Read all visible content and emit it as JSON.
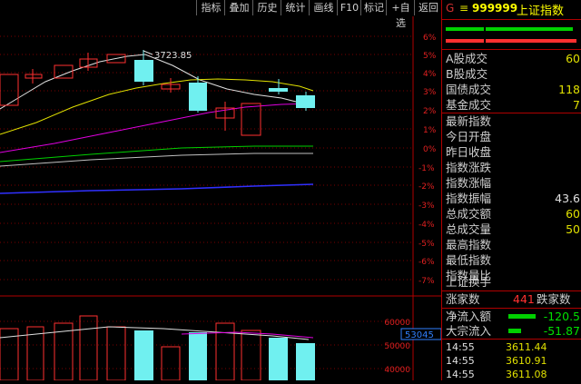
{
  "toolbar": {
    "buttons": [
      {
        "label": "指标"
      },
      {
        "label": "叠加"
      },
      {
        "label": "历史"
      },
      {
        "label": "统计"
      },
      {
        "label": "画线"
      },
      {
        "label": "F10"
      },
      {
        "label": "标记"
      },
      {
        "label": "+自选"
      },
      {
        "label": "返回"
      }
    ]
  },
  "chart": {
    "high_annotation": "3723.85",
    "y_ticks": [
      "6%",
      "5%",
      "4%",
      "3%",
      "2%",
      "1%",
      "0%",
      "-1%",
      "-2%",
      "-3%",
      "-4%",
      "-5%",
      "-6%",
      "-7%"
    ],
    "volume_ticks": [
      "60000",
      "50000",
      "40000"
    ],
    "volume_current": "53045"
  },
  "panel": {
    "g_label": "G",
    "eq": "≡",
    "code": "999999",
    "name": "上证指数",
    "rows": [
      {
        "label": "A股成交",
        "value": "60"
      },
      {
        "label": "B股成交",
        "value": ""
      },
      {
        "label": "国债成交",
        "value": "118"
      },
      {
        "label": "基金成交",
        "value": "7"
      },
      {
        "label": "最新指数",
        "value": ""
      },
      {
        "label": "今日开盘",
        "value": ""
      },
      {
        "label": "昨日收盘",
        "value": ""
      },
      {
        "label": "指数涨跌",
        "value": ""
      },
      {
        "label": "指数涨幅",
        "value": ""
      },
      {
        "label": "指数振幅",
        "value": "43.6"
      },
      {
        "label": "总成交额",
        "value": "60"
      },
      {
        "label": "总成交量",
        "value": "50"
      },
      {
        "label": "最高指数",
        "value": ""
      },
      {
        "label": "最低指数",
        "value": ""
      },
      {
        "label": "指数量比",
        "value": ""
      },
      {
        "label": "上证换手",
        "value": ""
      }
    ],
    "updown": {
      "rise_label": "涨家数",
      "count": "441",
      "fall_label": "跌家数"
    },
    "flows": [
      {
        "label": "净流入额",
        "value": "-120.5"
      },
      {
        "label": "大宗流入",
        "value": "-51.87"
      }
    ],
    "ticks": [
      {
        "time": "14:55",
        "price": "3611.44"
      },
      {
        "time": "14:55",
        "price": "3610.91"
      },
      {
        "time": "14:55",
        "price": "3611.08"
      }
    ]
  }
}
